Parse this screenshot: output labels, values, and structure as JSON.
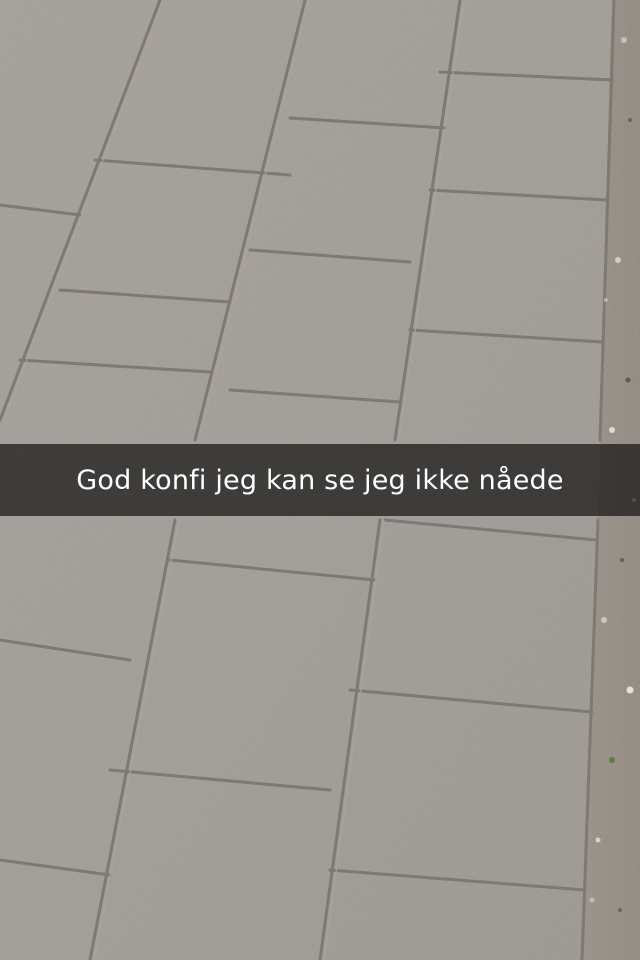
{
  "snap": {
    "caption": "God konfi jeg kan se jeg ikke nåede"
  },
  "colors": {
    "pavement": "#9c9791",
    "joint": "#7a7570",
    "gravel": "#8e857b",
    "caption_bar": "#000000",
    "caption_text": "#ffffff"
  }
}
